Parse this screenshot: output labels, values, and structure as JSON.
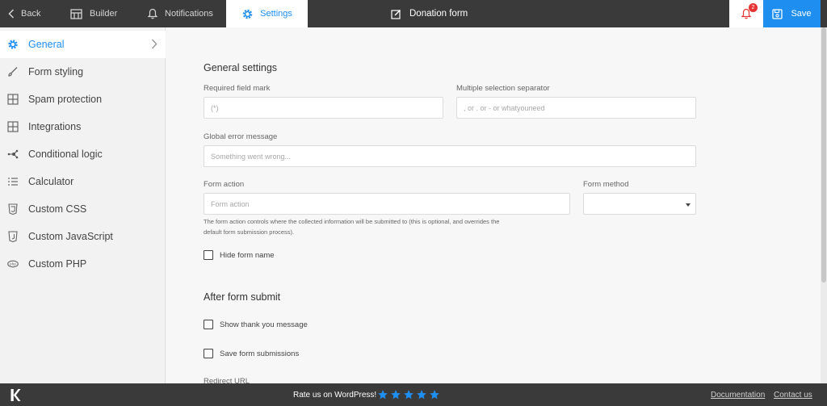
{
  "topbar": {
    "back": "Back",
    "builder": "Builder",
    "notifications": "Notifications",
    "settings": "Settings",
    "form_title": "Donation form",
    "notification_count": "2",
    "save": "Save"
  },
  "sidebar": {
    "items": [
      {
        "label": "General",
        "icon": "gear-icon",
        "active": true
      },
      {
        "label": "Form styling",
        "icon": "brush-icon"
      },
      {
        "label": "Spam protection",
        "icon": "grid-icon"
      },
      {
        "label": "Integrations",
        "icon": "grid-icon"
      },
      {
        "label": "Conditional logic",
        "icon": "network-icon"
      },
      {
        "label": "Calculator",
        "icon": "list-icon"
      },
      {
        "label": "Custom CSS",
        "icon": "css-icon"
      },
      {
        "label": "Custom JavaScript",
        "icon": "js-icon"
      },
      {
        "label": "Custom PHP",
        "icon": "php-icon"
      }
    ]
  },
  "general": {
    "heading": "General settings",
    "required_mark_label": "Required field mark",
    "required_mark_placeholder": "(*)",
    "separator_label": "Multiple selection separator",
    "separator_placeholder": ", or . or - or whatyouneed",
    "error_label": "Global error message",
    "error_placeholder": "Something went wrong...",
    "action_label": "Form action",
    "action_placeholder": "Form action",
    "method_label": "Form method",
    "method_value": "",
    "action_help_1": "The form action controls where the collected information will be submitted to (this is optional, and overrides the",
    "action_help_2": "default form submission process).",
    "hide_name_label": "Hide form name"
  },
  "after_submit": {
    "heading": "After form submit",
    "thank_you_label": "Show thank you message",
    "save_submissions_label": "Save form submissions",
    "redirect_label": "Redirect URL"
  },
  "footer": {
    "rate_text": "Rate us on WordPress!",
    "stars": 5,
    "documentation": "Documentation",
    "contact": "Contact us"
  },
  "colors": {
    "accent": "#1f8ef1",
    "dark": "#3a3a3a",
    "badge": "#e63333"
  }
}
